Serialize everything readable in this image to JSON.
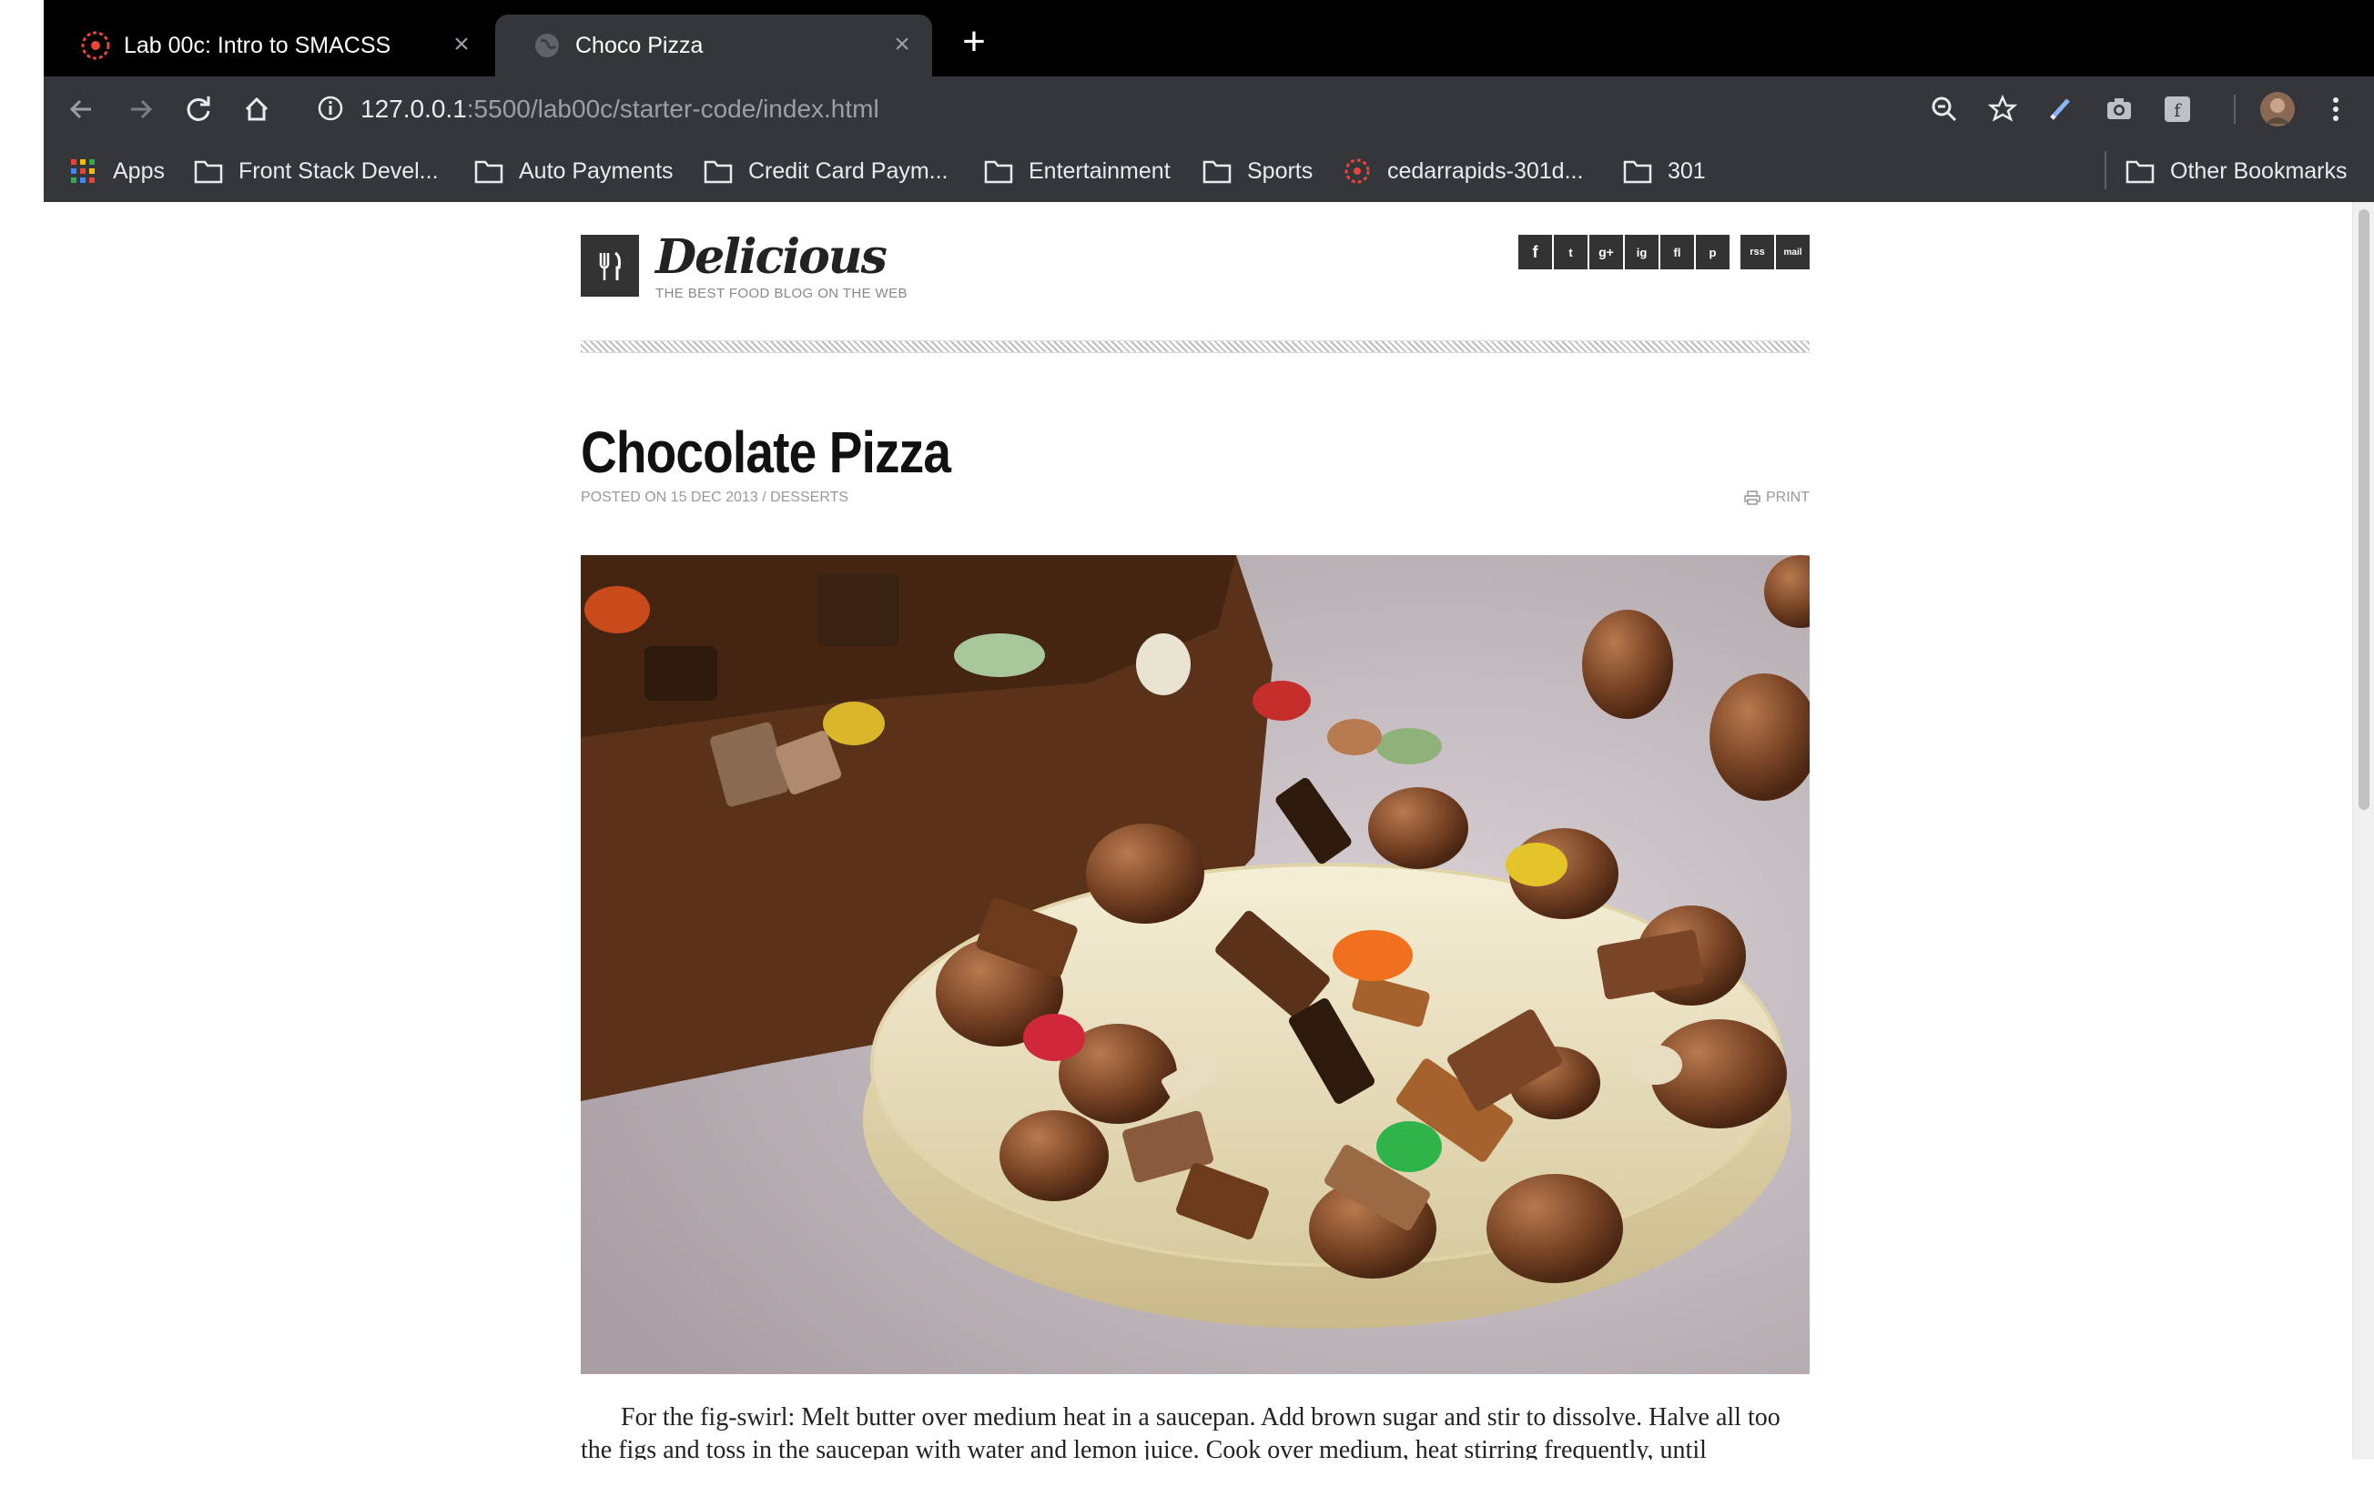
{
  "browser": {
    "tabs": [
      {
        "title": "Lab 00c: Intro to SMACSS",
        "favicon": "canvas-logo-icon",
        "active": false
      },
      {
        "title": "Choco Pizza",
        "favicon": "globe-icon",
        "active": true
      }
    ],
    "address": {
      "host": "127.0.0.1",
      "rest": ":5500/lab00c/starter-code/index.html"
    },
    "bookmarks": [
      {
        "label": "Apps",
        "icon": "apps-grid-icon"
      },
      {
        "label": "Front Stack Devel...",
        "icon": "folder-icon"
      },
      {
        "label": "Auto Payments",
        "icon": "folder-icon"
      },
      {
        "label": "Credit Card Paym...",
        "icon": "folder-icon"
      },
      {
        "label": "Entertainment",
        "icon": "folder-icon"
      },
      {
        "label": "Sports",
        "icon": "folder-icon"
      },
      {
        "label": "cedarrapids-301d...",
        "icon": "canvas-logo-icon"
      },
      {
        "label": "301",
        "icon": "folder-icon"
      }
    ],
    "other_bookmarks": "Other Bookmarks"
  },
  "site": {
    "name": "Delicious",
    "tagline": "THE BEST FOOD BLOG ON THE WEB",
    "social": [
      "f",
      "t",
      "g+",
      "ig",
      "fl",
      "p",
      "rss",
      "mail"
    ]
  },
  "post": {
    "title": "Chocolate Pizza",
    "meta": "POSTED ON 15 DEC 2013 / DESSERTS",
    "print_label": "PRINT",
    "body": "For the fig-swirl: Melt butter over medium heat in a saucepan. Add brown sugar and stir to dissolve. Halve all too the figs and toss in the saucepan with water and lemon juice. Cook over medium, heat stirring frequently, until"
  },
  "colors": {
    "chrome_dark": "#000000",
    "toolbar": "#35363a",
    "logo_box": "#333333",
    "accent_red": "#e8453c"
  }
}
